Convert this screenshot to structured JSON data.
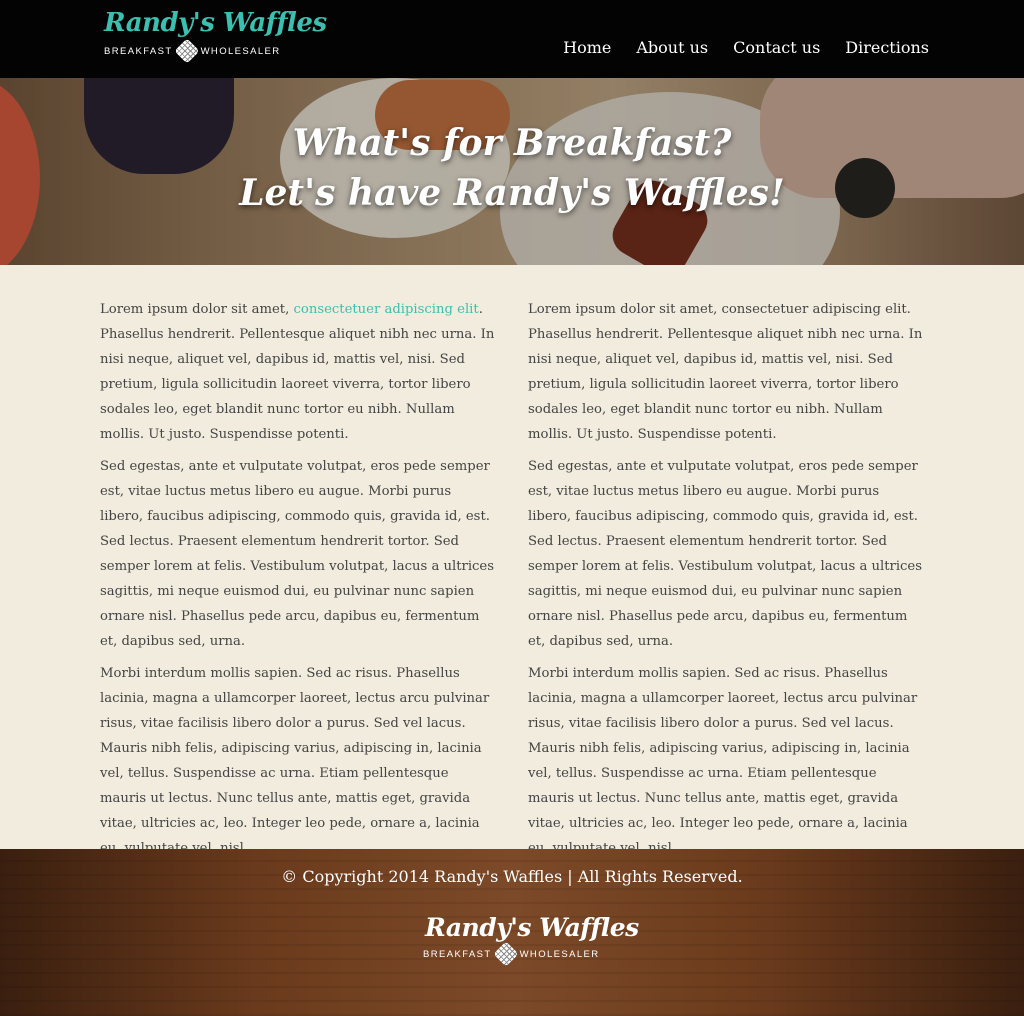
{
  "header": {
    "logo": {
      "title": "Randy's Waffles",
      "left_text": "BREAKFAST",
      "right_text": "WHOLESALER"
    },
    "nav": [
      "Home",
      "About us",
      "Contact us",
      "Directions"
    ]
  },
  "hero": {
    "line1": "What's for Breakfast?",
    "line2": "Let's have Randy's Waffles!"
  },
  "content": {
    "left": {
      "p1_start": "Lorem ipsum dolor sit amet, ",
      "p1_link": "consectetuer adipiscing elit",
      "p1_end": ". Phasellus hendrerit. Pellentesque aliquet nibh nec urna. In nisi neque, aliquet vel, dapibus id, mattis vel, nisi. Sed pretium, ligula sollicitudin laoreet viverra, tortor libero sodales leo, eget blandit nunc tortor eu nibh. Nullam mollis. Ut justo. Suspendisse potenti.",
      "p2": "Sed egestas, ante et vulputate volutpat, eros pede semper est, vitae luctus metus libero eu augue. Morbi purus libero, faucibus adipiscing, commodo quis, gravida id, est. Sed lectus. Praesent elementum hendrerit tortor. Sed semper lorem at felis. Vestibulum volutpat, lacus a ultrices sagittis, mi neque euismod dui, eu pulvinar nunc sapien ornare nisl. Phasellus pede arcu, dapibus eu, fermentum et, dapibus sed, urna.",
      "p3": "Morbi interdum mollis sapien. Sed ac risus. Phasellus lacinia, magna a ullamcorper laoreet, lectus arcu pulvinar risus, vitae facilisis libero dolor a purus. Sed vel lacus. Mauris nibh felis, adipiscing varius, adipiscing in, lacinia vel, tellus. Suspendisse ac urna. Etiam pellentesque mauris ut lectus. Nunc tellus ante, mattis eget, gravida vitae, ultricies ac, leo. Integer leo pede, ornare a, lacinia eu, vulputate vel, nisl."
    },
    "right": {
      "p1": "Lorem ipsum dolor sit amet, consectetuer adipiscing elit. Phasellus hendrerit. Pellentesque aliquet nibh nec urna. In nisi neque, aliquet vel, dapibus id, mattis vel, nisi. Sed pretium, ligula sollicitudin laoreet viverra, tortor libero sodales leo, eget blandit nunc tortor eu nibh. Nullam mollis. Ut justo. Suspendisse potenti.",
      "p2": "Sed egestas, ante et vulputate volutpat, eros pede semper est, vitae luctus metus libero eu augue. Morbi purus libero, faucibus adipiscing, commodo quis, gravida id, est. Sed lectus. Praesent elementum hendrerit tortor. Sed semper lorem at felis. Vestibulum volutpat, lacus a ultrices sagittis, mi neque euismod dui, eu pulvinar nunc sapien ornare nisl. Phasellus pede arcu, dapibus eu, fermentum et, dapibus sed, urna.",
      "p3": "Morbi interdum mollis sapien. Sed ac risus. Phasellus lacinia, magna a ullamcorper laoreet, lectus arcu pulvinar risus, vitae facilisis libero dolor a purus. Sed vel lacus. Mauris nibh felis, adipiscing varius, adipiscing in, lacinia vel, tellus. Suspendisse ac urna. Etiam pellentesque mauris ut lectus. Nunc tellus ante, mattis eget, gravida vitae, ultricies ac, leo. Integer leo pede, ornare a, lacinia eu, vulputate vel, nisl."
    }
  },
  "footer": {
    "copyright": "© Copyright 2014 Randy's Waffles | All Rights Reserved.",
    "logo": {
      "title": "Randy's Waffles",
      "left_text": "BREAKFAST",
      "right_text": "WHOLESALER"
    }
  },
  "colors": {
    "accent": "#3bbfb0",
    "header_bg": "#030303",
    "body_bg": "#f1ecdd",
    "footer_wood": "#6a3a1c"
  }
}
